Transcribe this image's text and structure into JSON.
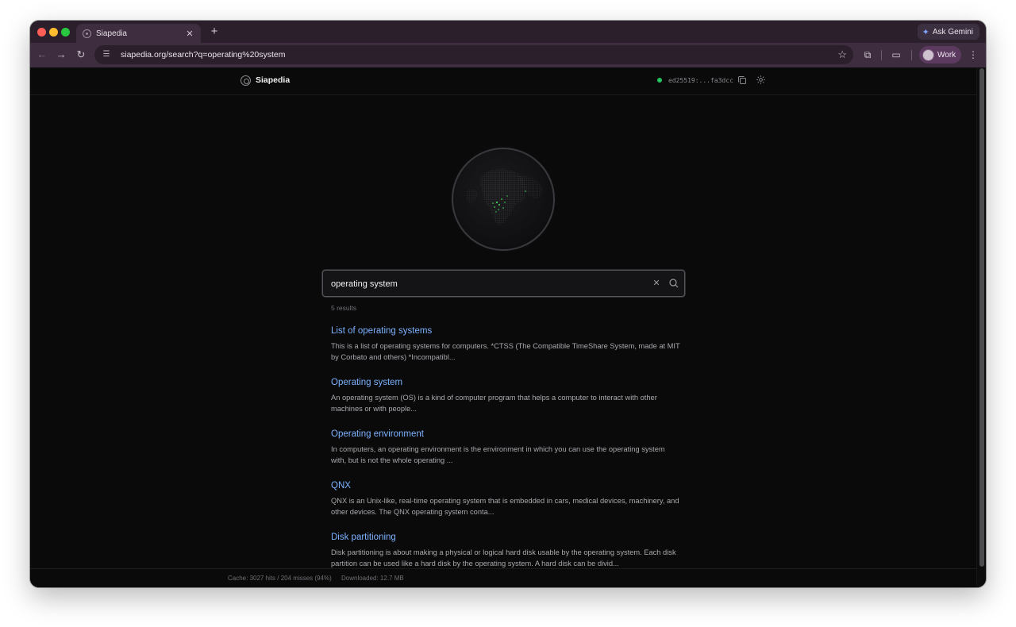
{
  "browser": {
    "tab_title": "Siapedia",
    "new_tab_label": "+",
    "ask_gemini_label": "Ask Gemini",
    "url": "siapedia.org/search?q=operating%20system",
    "profile_label": "Work",
    "icons": [
      "back-icon",
      "forward-icon",
      "reload-icon",
      "site-info-icon",
      "star-icon",
      "extensions-icon",
      "side-panel-icon",
      "menu-icon"
    ]
  },
  "app": {
    "brand": "Siapedia",
    "status_color": "#22c55e",
    "key_id": "ed25519:...fa3dcc",
    "accent_color": "#7cb2ff"
  },
  "search": {
    "query": "operating system",
    "results_count": "5 results"
  },
  "results": [
    {
      "title": "List of operating systems",
      "snippet": "This is a list of operating systems for computers. *CTSS (The Compatible TimeShare System, made at MIT by Corbato and others) *Incompatibl..."
    },
    {
      "title": "Operating system",
      "snippet": "An operating system (OS) is a kind of computer program that helps a computer to interact with other machines or with people..."
    },
    {
      "title": "Operating environment",
      "snippet": "In computers, an operating environment is the environment in which you can use the operating system with, but is not the whole operating ..."
    },
    {
      "title": "QNX",
      "snippet": "QNX is an Unix-like, real-time operating system that is embedded in cars, medical devices, machinery, and other devices. The QNX operating system conta..."
    },
    {
      "title": "Disk partitioning",
      "snippet": "Disk partitioning is about making a physical or logical hard disk usable by the operating system. Each disk partition can be used like a hard disk by the operating system. A hard disk can be divid..."
    }
  ],
  "footer": {
    "cache": "Cache: 3027 hits / 204 misses (94%)",
    "downloaded": "Downloaded: 12.7 MB"
  }
}
